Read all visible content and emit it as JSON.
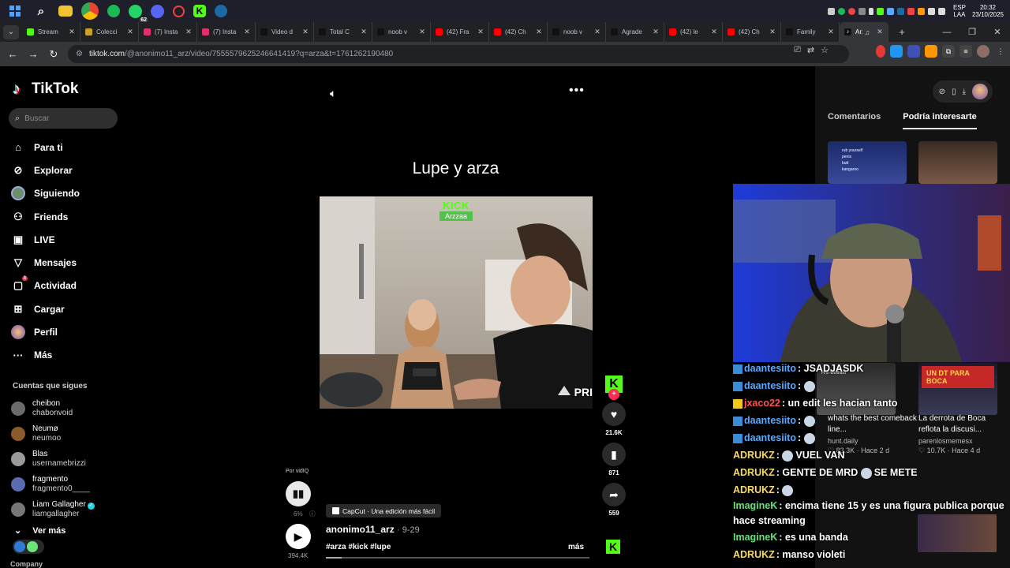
{
  "taskbar": {
    "icons": [
      "windows-start-icon",
      "search-icon",
      "file-explorer-icon",
      "chrome-icon",
      "spotify-icon",
      "whatsapp-icon",
      "discord-icon",
      "app-icon",
      "kick-icon",
      "steam-icon"
    ],
    "whatsapp_badge": "62",
    "lang_line1": "ESP",
    "lang_line2": "LAA",
    "time": "20:32",
    "date": "23/10/2025"
  },
  "browser": {
    "tabs": [
      {
        "title": "Stream",
        "fav": "#53fc18",
        "icon": "kick-icon"
      },
      {
        "title": "Colecci",
        "fav": "#c9a227",
        "icon": "collection-icon"
      },
      {
        "title": "(7) Insta",
        "fav": "#e1306c",
        "icon": "instagram-icon"
      },
      {
        "title": "(7) Insta",
        "fav": "#e1306c",
        "icon": "instagram-icon"
      },
      {
        "title": "Video d",
        "fav": "#111111",
        "icon": "tiktok-icon"
      },
      {
        "title": "Total C",
        "fav": "#111111",
        "icon": "tiktok-icon"
      },
      {
        "title": "noob v",
        "fav": "#111111",
        "icon": "tiktok-icon"
      },
      {
        "title": "(42) Fra",
        "fav": "#ff0000",
        "icon": "youtube-icon"
      },
      {
        "title": "(42) Ch",
        "fav": "#ff0000",
        "icon": "youtube-icon"
      },
      {
        "title": "noob v",
        "fav": "#111111",
        "icon": "tiktok-icon"
      },
      {
        "title": "Agrade",
        "fav": "#111111",
        "icon": "tiktok-icon"
      },
      {
        "title": "(42) le",
        "fav": "#ff0000",
        "icon": "youtube-icon"
      },
      {
        "title": "(42) Ch",
        "fav": "#ff0000",
        "icon": "youtube-icon"
      },
      {
        "title": "Family",
        "fav": "#111111",
        "icon": "tiktok-icon"
      }
    ],
    "active_tab": {
      "title": "Arz",
      "fav": "#111111",
      "icon": "tiktok-icon"
    },
    "url_host": "tiktok.com",
    "url_path": "/@anonimo11_arz/video/7555579625246641419?q=arza&t=1761262190480"
  },
  "sidebar": {
    "logo_text": "TikTok",
    "search_placeholder": "Buscar",
    "nav": [
      {
        "label": "Para ti",
        "icon": "home-icon",
        "glyph": "⌂"
      },
      {
        "label": "Explorar",
        "icon": "compass-icon",
        "glyph": "⊘"
      },
      {
        "label": "Siguiendo",
        "icon": "following-avatar-icon",
        "glyph": "◉"
      },
      {
        "label": "Friends",
        "icon": "friends-icon",
        "glyph": "⚇"
      },
      {
        "label": "LIVE",
        "icon": "live-icon",
        "glyph": "▣"
      },
      {
        "label": "Mensajes",
        "icon": "messages-icon",
        "glyph": "▽"
      },
      {
        "label": "Actividad",
        "icon": "activity-icon",
        "glyph": "▢"
      },
      {
        "label": "Cargar",
        "icon": "upload-icon",
        "glyph": "⊞"
      },
      {
        "label": "Perfil",
        "icon": "profile-avatar-icon",
        "glyph": "●"
      },
      {
        "label": "Más",
        "icon": "more-icon",
        "glyph": "···"
      }
    ],
    "activity_badge": "3",
    "following_header": "Cuentas que sigues",
    "following": [
      {
        "name": "cheibon",
        "user": "chabonvoid",
        "color": "#6b6b6b",
        "verified": false
      },
      {
        "name": "Neumø",
        "user": "neumoo",
        "color": "#8a5a2b",
        "verified": false
      },
      {
        "name": "Blas",
        "user": "usernamebrizzi",
        "color": "#9a9a9a",
        "verified": false
      },
      {
        "name": "fragmento",
        "user": "fragmento0____",
        "color": "#5b6bb0",
        "verified": false
      },
      {
        "name": "Liam Gallagher",
        "user": "liamgallagher",
        "color": "#777777",
        "verified": true
      }
    ],
    "see_more": "Ver más",
    "company": "Company"
  },
  "video": {
    "overlay_title": "Lupe y arza",
    "kick_label": "KICK",
    "kick_user": "Arzzaa",
    "pri_tag": "PRI",
    "by_label": "Por vidIQ",
    "percent": "6%",
    "views": "394.4K",
    "capcut_label": "CapCut · Una edición más fácil",
    "author": "anonimo11_arz",
    "date": "· 9-29",
    "tags": "#arza #kick #lupe",
    "more": "más",
    "progress": 0.06,
    "likes": "21.6K",
    "saves": "871",
    "shares": "559"
  },
  "right_panel": {
    "tabs": [
      "Comentarios",
      "Podría interesarte"
    ],
    "active_tab": 1,
    "thumb_text": [
      "rub yourself",
      "penis",
      "butt",
      "kangaroo"
    ],
    "cards": [
      {
        "title": "whats the best comeback line...",
        "user": "hunt.daily",
        "meta": "♡ 83.3K · Hace 2 d",
        "thumb_text": "Finn Wolfhard"
      },
      {
        "title": "La derrota de Boca reflota la discusi...",
        "user": "parenlosmemesx",
        "meta": "♡ 10.7K · Hace 4 d",
        "thumb_text": "UN DT PARA BOCA"
      }
    ]
  },
  "chat": {
    "colors": {
      "daantesiito": "#5aa9ff",
      "jxaco22": "#ff4f4f",
      "ADRUKZ": "#f5d96b",
      "ImagineK": "#68e07a"
    },
    "messages": [
      {
        "nick": "daantesiito",
        "text": "JSADJASDK",
        "color": "#5aa9ff",
        "emote": false
      },
      {
        "nick": "daantesiito",
        "text": "",
        "color": "#5aa9ff",
        "emote": true
      },
      {
        "nick": "jxaco22",
        "text": "un edit les hacian tanto",
        "color": "#ff4f4f",
        "emote": false
      },
      {
        "nick": "daantesiito",
        "text": "",
        "color": "#5aa9ff",
        "emote": true
      },
      {
        "nick": "daantesiito",
        "text": "",
        "color": "#5aa9ff",
        "emote": true
      },
      {
        "nick": "ADRUKZ",
        "text": "VUEL VAN",
        "color": "#f5d96b",
        "emote": true
      },
      {
        "nick": "ADRUKZ",
        "text": "GENTE DE MRD",
        "color": "#f5d96b",
        "emote": false,
        "suffix": "SE METE"
      },
      {
        "nick": "ADRUKZ",
        "text": "",
        "color": "#f5d96b",
        "emote": true
      },
      {
        "nick": "ImagineK",
        "text": "encima tiene 15 y es una figura publica porque hace streaming",
        "color": "#68e07a",
        "emote": false
      },
      {
        "nick": "ImagineK",
        "text": "es una banda",
        "color": "#68e07a",
        "emote": false
      },
      {
        "nick": "ADRUKZ",
        "text": "manso violeti",
        "color": "#f5d96b",
        "emote": false
      }
    ]
  }
}
